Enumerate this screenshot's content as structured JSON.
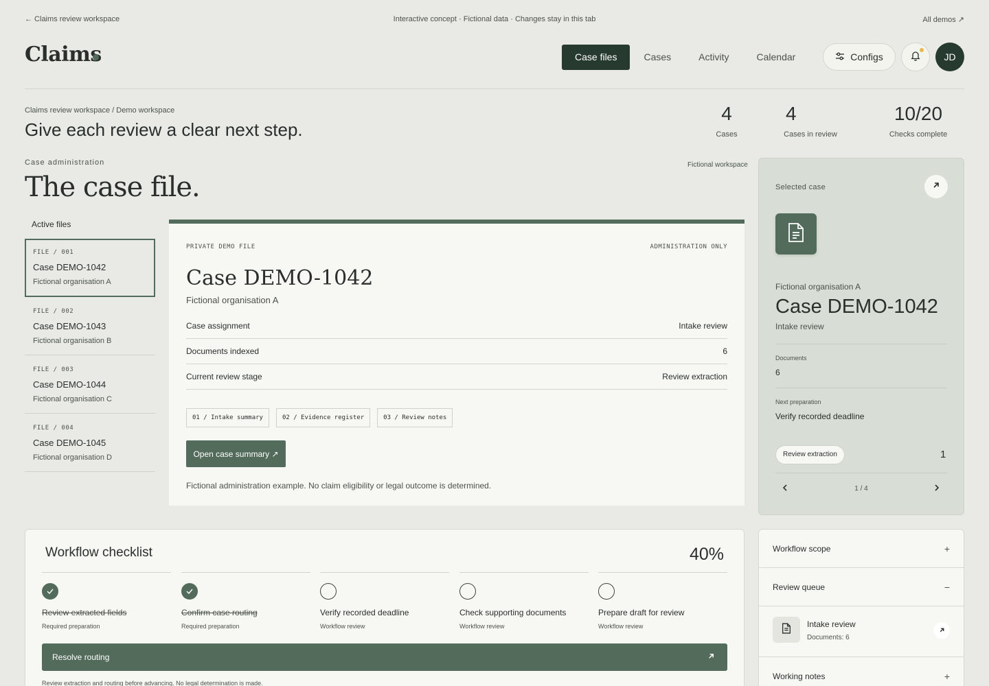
{
  "topbar": {
    "back_link": "← Claims review workspace",
    "notice": "Interactive concept · Fictional data · Changes stay in this tab",
    "all_demos": "All demos ↗"
  },
  "header": {
    "logo": "Claims",
    "nav": [
      {
        "label": "Case files",
        "active": true
      },
      {
        "label": "Cases",
        "active": false
      },
      {
        "label": "Activity",
        "active": false
      },
      {
        "label": "Calendar",
        "active": false
      }
    ],
    "configs_label": "Configs",
    "avatar_initials": "JD",
    "notification_dot_color": "#e6b94a"
  },
  "hero": {
    "breadcrumb": "Claims review workspace / Demo workspace",
    "title": "Give each review a clear next step.",
    "stats": [
      {
        "value": "4",
        "label": "Cases"
      },
      {
        "value": "4",
        "label": "Cases in review"
      },
      {
        "value": "10/20",
        "label": "Checks complete"
      }
    ]
  },
  "section": {
    "eyebrow": "Case administration",
    "title": "The case file.",
    "workspace_tag": "Fictional workspace"
  },
  "files": {
    "label": "Active files",
    "items": [
      {
        "code": "FILE / 001",
        "name": "Case DEMO-1042",
        "org": "Fictional organisation A",
        "selected": true
      },
      {
        "code": "FILE / 002",
        "name": "Case DEMO-1043",
        "org": "Fictional organisation B",
        "selected": false
      },
      {
        "code": "FILE / 003",
        "name": "Case DEMO-1044",
        "org": "Fictional organisation C",
        "selected": false
      },
      {
        "code": "FILE / 004",
        "name": "Case DEMO-1045",
        "org": "Fictional organisation D",
        "selected": false
      }
    ]
  },
  "case_card": {
    "tag_left": "PRIVATE DEMO FILE",
    "tag_right": "ADMINISTRATION ONLY",
    "title": "Case DEMO-1042",
    "org": "Fictional organisation A",
    "rows": [
      {
        "key": "Case assignment",
        "value": "Intake review"
      },
      {
        "key": "Documents indexed",
        "value": "6"
      },
      {
        "key": "Current review stage",
        "value": "Review extraction"
      }
    ],
    "chips": [
      "01 / Intake summary",
      "02 / Evidence register",
      "03 / Review notes"
    ],
    "open_button": "Open case summary ↗",
    "disclaimer": "Fictional administration example. No claim eligibility or legal outcome is determined."
  },
  "selected_case": {
    "label": "Selected case",
    "org": "Fictional organisation A",
    "title": "Case DEMO-1042",
    "stage": "Intake review",
    "documents_label": "Documents",
    "documents_value": "6",
    "next_label": "Next preparation",
    "next_value": "Verify recorded deadline",
    "pill": "Review extraction",
    "pill_count": "1",
    "pager": "1 / 4"
  },
  "checklist": {
    "title": "Workflow checklist",
    "percent": "40%",
    "steps": [
      {
        "label": "Review extracted fields",
        "sub": "Required preparation",
        "done": true
      },
      {
        "label": "Confirm case routing",
        "sub": "Required preparation",
        "done": true
      },
      {
        "label": "Verify recorded deadline",
        "sub": "Workflow review",
        "done": false
      },
      {
        "label": "Check supporting documents",
        "sub": "Workflow review",
        "done": false
      },
      {
        "label": "Prepare draft for review",
        "sub": "Workflow review",
        "done": false
      }
    ],
    "resolve_button": "Resolve routing",
    "note": "Review extraction and routing before advancing. No legal determination is made."
  },
  "accordion": {
    "workflow_scope": "Workflow scope",
    "review_queue": "Review queue",
    "queue_item_title": "Intake review",
    "queue_item_sub": "Documents: 6",
    "working_notes": "Working notes",
    "plus": "+",
    "minus": "−"
  },
  "colors": {
    "accent": "#536b5b",
    "dark": "#263a30",
    "background": "#e9eae5",
    "panel": "#d8ddd5"
  }
}
